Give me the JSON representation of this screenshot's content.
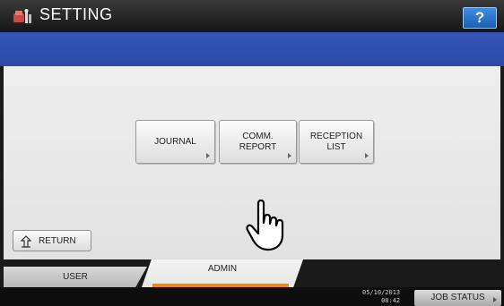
{
  "header": {
    "title": "SETTING",
    "help_label": "?"
  },
  "menu": {
    "buttons": [
      {
        "line1": "JOURNAL",
        "line2": ""
      },
      {
        "line1": "COMM.",
        "line2": "REPORT"
      },
      {
        "line1": "RECEPTION",
        "line2": "LIST"
      }
    ]
  },
  "return_label": "RETURN",
  "tabs": {
    "user": "USER",
    "admin": "ADMIN",
    "active": "admin"
  },
  "status": {
    "date": "05/10/2013",
    "time": "08:42",
    "job_status_label": "JOB STATUS"
  },
  "icons": {
    "app": "setting-icon",
    "return": "return-arrow-icon",
    "pointer": "hand-pointer-icon",
    "button_arrow": "triangle-right-icon"
  },
  "colors": {
    "accent_blue": "#2d4fae",
    "tab_underline": "#f08a00",
    "help_blue": "#2a72cf"
  }
}
